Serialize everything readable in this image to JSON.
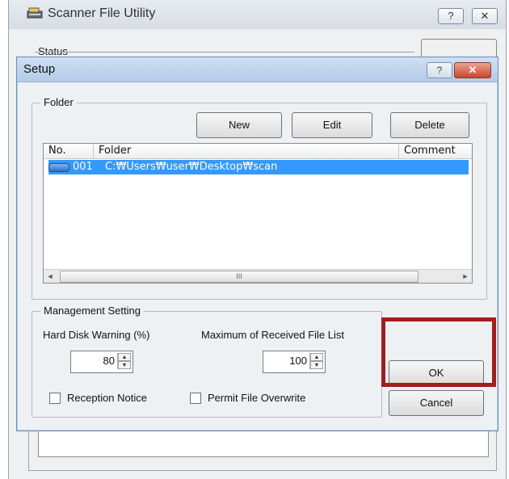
{
  "parent_window": {
    "title": "Scanner File Utility",
    "help_glyph": "?",
    "close_glyph": "✕",
    "status_label": "Status"
  },
  "dialog": {
    "title": "Setup",
    "help_glyph": "?",
    "close_glyph": "✕",
    "folder_group": {
      "label": "Folder",
      "buttons": {
        "new": "New",
        "edit": "Edit",
        "delete": "Delete"
      },
      "columns": [
        "No.",
        "Folder",
        "Comment"
      ],
      "rows": [
        {
          "no": "001",
          "folder": "C:₩Users₩user₩Desktop₩scan",
          "comment": "",
          "selected": true
        }
      ],
      "scroll_left": "◄",
      "scroll_right": "►",
      "scroll_thumb_grip": "III"
    },
    "management_group": {
      "label": "Management Setting",
      "hard_disk_label": "Hard Disk Warning (%)",
      "hard_disk_value": "80",
      "max_list_label": "Maximum of Received File List",
      "max_list_value": "100",
      "reception_notice_label": "Reception Notice",
      "reception_notice_checked": false,
      "permit_overwrite_label": "Permit File Overwrite",
      "permit_overwrite_checked": false
    },
    "ok_label": "OK",
    "cancel_label": "Cancel"
  },
  "colors": {
    "selection": "#3399ff",
    "highlight_box": "#a31d1d",
    "title_bar": "#b4cbe6"
  }
}
